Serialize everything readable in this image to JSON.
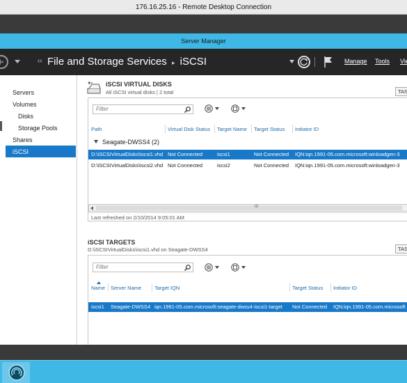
{
  "rdp": {
    "title": "176.16.25.16 - Remote Desktop Connection"
  },
  "window": {
    "title": "Server Manager"
  },
  "nav": {
    "crumb_root": "File and Storage Services",
    "crumb_sep": "▸",
    "crumb_current": "iSCSI",
    "menus": [
      "Manage",
      "Tools",
      "Vie"
    ]
  },
  "sidebar": {
    "items": [
      {
        "label": "Servers"
      },
      {
        "label": "Volumes"
      },
      {
        "label": "Disks"
      },
      {
        "label": "Storage Pools"
      },
      {
        "label": "Shares"
      },
      {
        "label": "iSCSI"
      }
    ]
  },
  "vdisks": {
    "title": "iSCSI VIRTUAL DISKS",
    "subtitle": "All iSCSI virtual disks | 2 total",
    "tasks": "TAS",
    "filter_placeholder": "Filter",
    "columns": [
      "Path",
      "Virtual Disk Status",
      "Target Name",
      "Target Status",
      "Initiator ID"
    ],
    "group": "Seagate-DWSS4 (2)",
    "rows": [
      {
        "path": "D:\\iSCSIVirtualDisks\\iscsi1.vhd",
        "vstatus": "Not Connected",
        "target": "iscsi1",
        "tstatus": "Not Connected",
        "initiator": "IQN:iqn.1991-05.com.microsoft:winloadgen-3"
      },
      {
        "path": "D:\\iSCSIVirtualDisks\\iscsi2.vhd",
        "vstatus": "Not Connected",
        "target": "iscsi2",
        "tstatus": "Not Connected",
        "initiator": "IQN:iqn.1991-05.com.microsoft:winloadgen-3"
      }
    ],
    "scroll_grip": "III",
    "last_refreshed": "Last refreshed on 2/10/2014 9:05:01 AM"
  },
  "targets": {
    "title": "iSCSI TARGETS",
    "subtitle": "D:\\iSCSIVirtualDisks\\iscsi1.vhd on Seagate-DWSS4",
    "tasks": "TAS",
    "filter_placeholder": "Filter",
    "columns": [
      "Name",
      "Server Name",
      "Target IQN",
      "Target Status",
      "Initiator ID"
    ],
    "rows": [
      {
        "name": "iscsi1",
        "server": "Seagate-DWSS4",
        "iqn": "iqn.1991-05.com.microsoft:seagate-dwss4-iscsi1-target",
        "tstatus": "Not Connected",
        "initiator": "IQN:iqn.1991-05.com.microsoft"
      }
    ]
  },
  "colors": {
    "accent": "#1979c9",
    "taskbar": "#3fb8e6",
    "nav": "#262626"
  }
}
